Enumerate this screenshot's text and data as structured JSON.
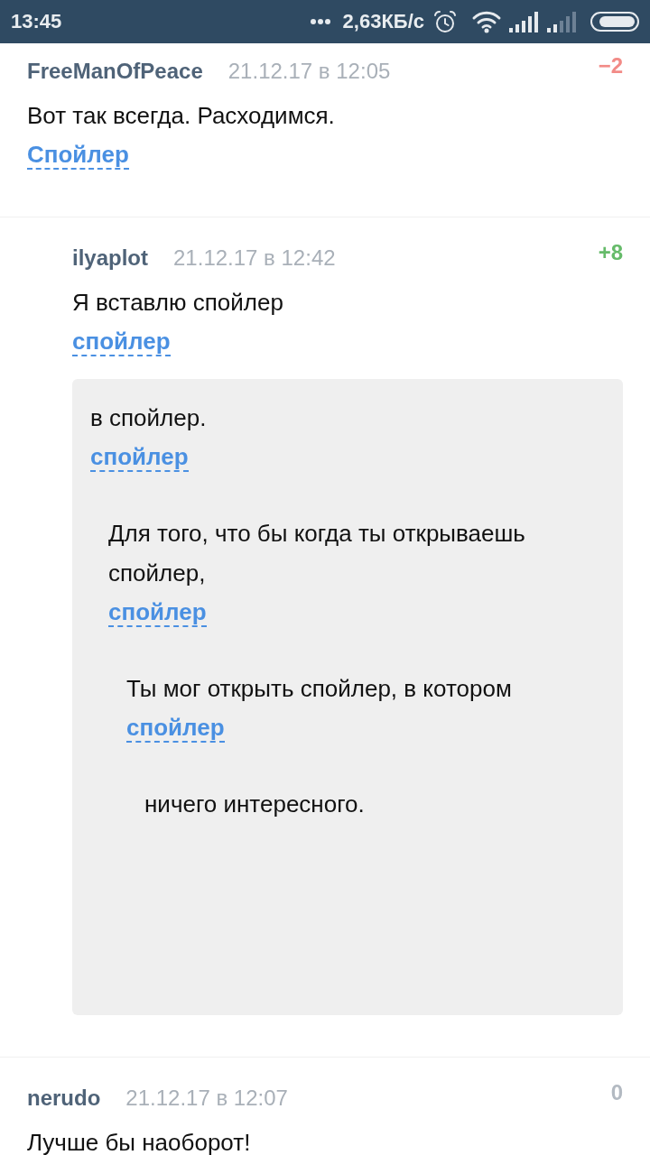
{
  "status_bar": {
    "time": "13:45",
    "speed": "2,63КБ/с"
  },
  "comments": [
    {
      "author": "FreeManOfPeace",
      "date": "21.12.17 в 12:05",
      "rating": {
        "value": "−2",
        "kind": "negative"
      },
      "body": [
        {
          "kind": "text",
          "text": "Вот так всегда. Расходимся."
        },
        {
          "kind": "spoiler",
          "label": "Спойлер"
        }
      ],
      "replies": [
        {
          "author": "ilyaplot",
          "date": "21.12.17 в 12:42",
          "rating": {
            "value": "+8",
            "kind": "positive"
          },
          "body": [
            {
              "kind": "text",
              "text": "Я вставлю спойлер"
            },
            {
              "kind": "spoiler",
              "label": "спойлер",
              "content": [
                {
                  "kind": "text",
                  "text": "в спойлер."
                },
                {
                  "kind": "spoiler",
                  "label": "спойлер",
                  "content": [
                    {
                      "kind": "text",
                      "text": "Для того, что бы когда ты открываешь спойлер,"
                    },
                    {
                      "kind": "spoiler",
                      "label": "спойлер",
                      "content": [
                        {
                          "kind": "text",
                          "text": "Ты мог открыть спойлер, в котором"
                        },
                        {
                          "kind": "spoiler",
                          "label": "спойлер",
                          "content": [
                            {
                              "kind": "text",
                              "text": "ничего интересного."
                            }
                          ]
                        }
                      ]
                    }
                  ]
                }
              ]
            }
          ]
        }
      ]
    },
    {
      "author": "nerudo",
      "date": "21.12.17 в 12:07",
      "rating": {
        "value": "0",
        "kind": "neutral"
      },
      "body": [
        {
          "kind": "text",
          "text": "Лучше бы наоборот!"
        }
      ]
    }
  ]
}
